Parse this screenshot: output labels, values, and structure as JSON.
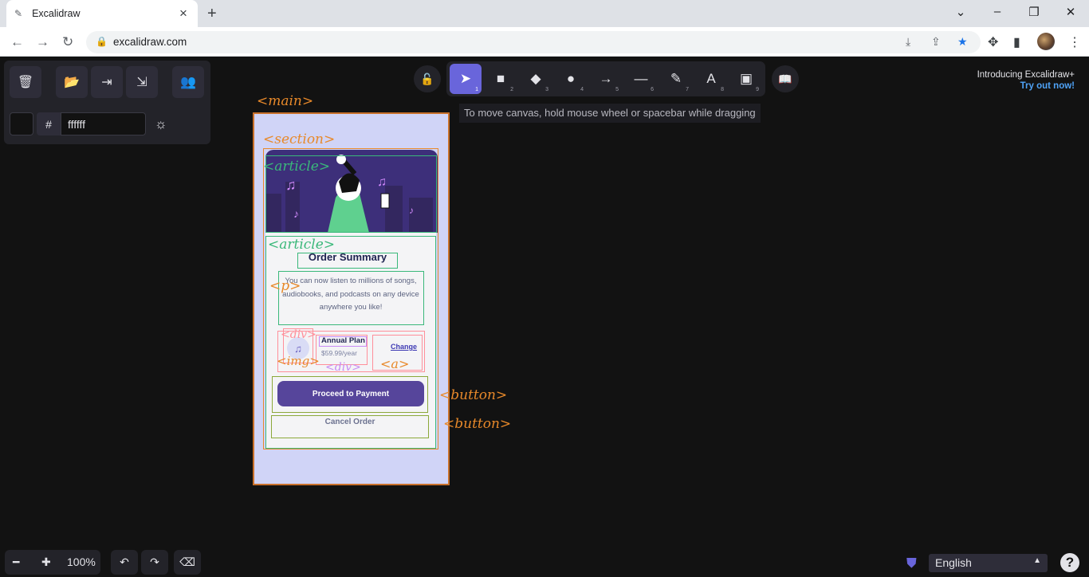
{
  "browser": {
    "tab_title": "Excalidraw",
    "url": "excalidraw.com"
  },
  "canvas_bg": "#121212",
  "accent": "#6965db",
  "left_panel": {
    "hash": "#",
    "hex_value": "ffffff",
    "buttons": [
      "trash-icon",
      "folder-open-icon",
      "export-icon",
      "export-image-icon",
      "collab-icon"
    ]
  },
  "toolbar": {
    "tools": [
      {
        "name": "selection",
        "key": "1",
        "glyph": "➤"
      },
      {
        "name": "rectangle",
        "key": "2",
        "glyph": "■"
      },
      {
        "name": "diamond",
        "key": "3",
        "glyph": "◆"
      },
      {
        "name": "ellipse",
        "key": "4",
        "glyph": "●"
      },
      {
        "name": "arrow",
        "key": "5",
        "glyph": "→"
      },
      {
        "name": "line",
        "key": "6",
        "glyph": "—"
      },
      {
        "name": "draw",
        "key": "7",
        "glyph": "✎"
      },
      {
        "name": "text",
        "key": "8",
        "glyph": "A"
      },
      {
        "name": "image",
        "key": "9",
        "glyph": "▣"
      }
    ],
    "hint": "To move canvas, hold mouse wheel or spacebar while dragging"
  },
  "promo": {
    "line1": "Introducing Excalidraw+",
    "line2": "Try out now!"
  },
  "annotations": {
    "main": "<main>",
    "section": "<section>",
    "article1": "<article>",
    "article2": "<article>",
    "p": "<p>",
    "div1": "<div>",
    "img": "<img>",
    "div2": "<div>",
    "a": "<a>",
    "button1": "<button>",
    "button2": "<button>"
  },
  "mockup": {
    "title": "Order Summary",
    "description": "You can now listen to millions of songs, audiobooks, and podcasts on any device anywhere you like!",
    "plan": "Annual Plan",
    "price": "$59.99/year",
    "change": "Change",
    "pay": "Proceed to Payment",
    "cancel": "Cancel Order"
  },
  "footer": {
    "zoom": "100%",
    "language": "English",
    "help": "?"
  }
}
